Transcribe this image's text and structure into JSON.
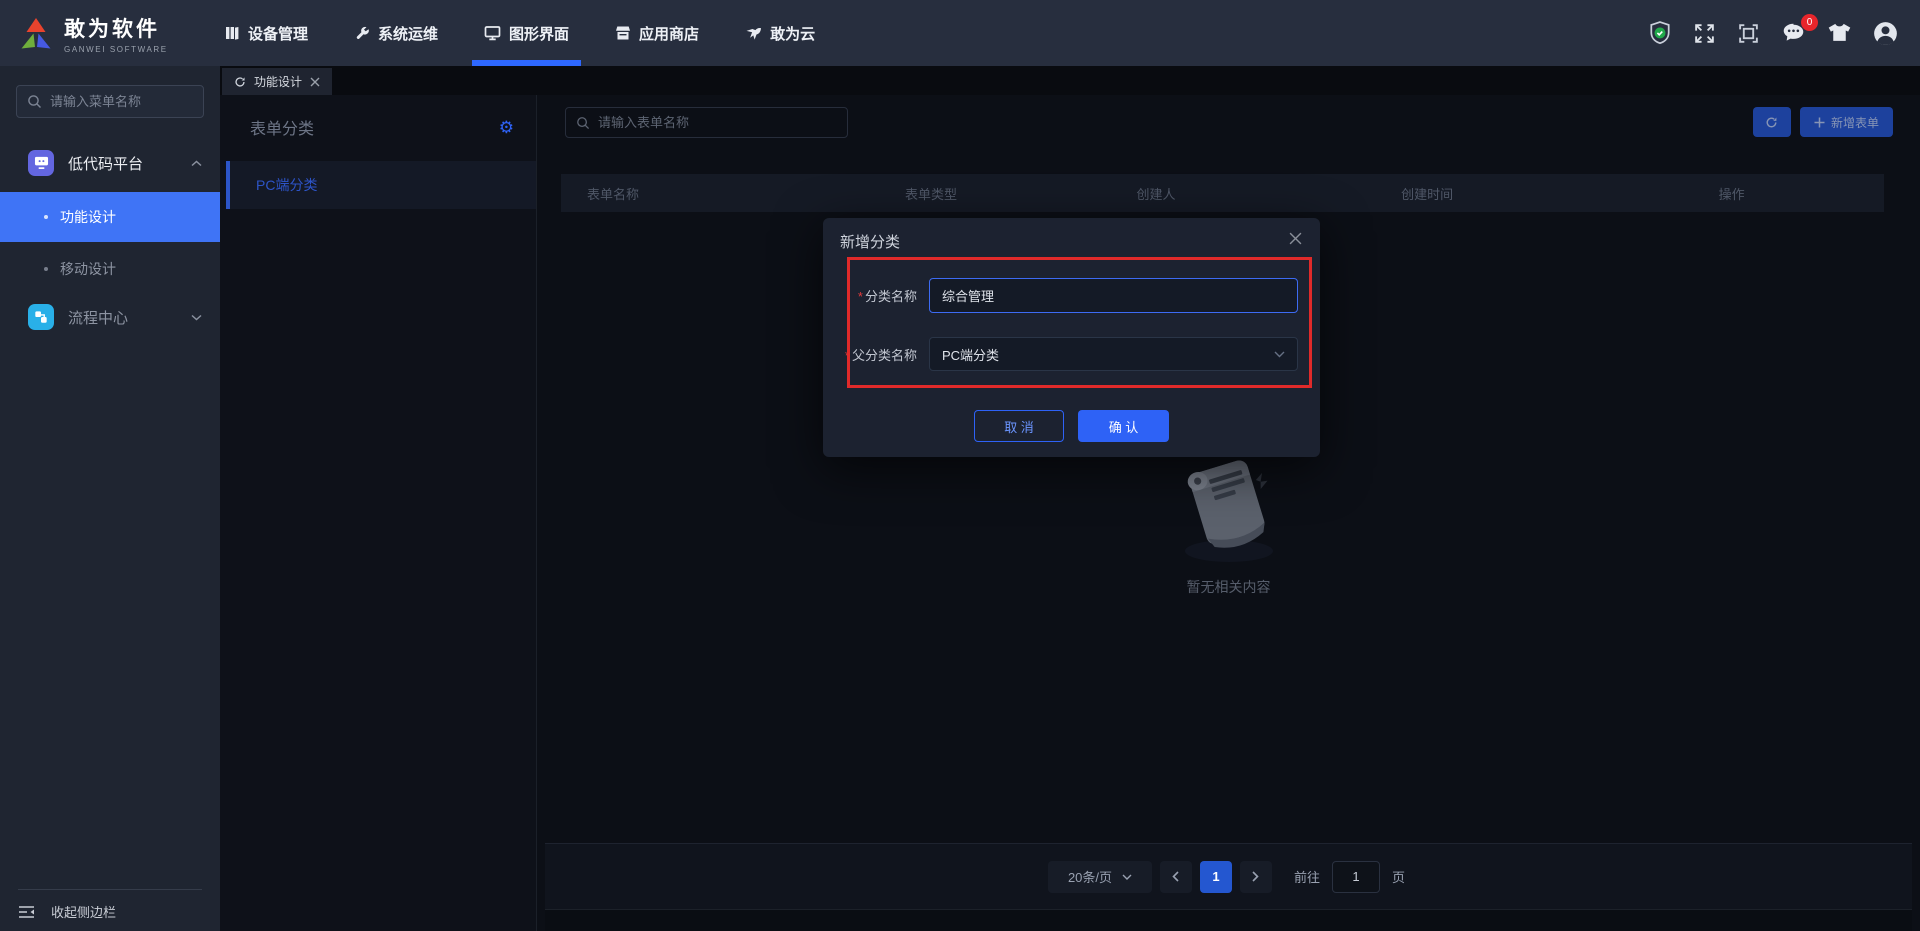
{
  "brand": {
    "name": "敢为软件",
    "subtitle": "GANWEI SOFTWARE"
  },
  "nav": {
    "items": [
      {
        "label": "设备管理",
        "icon": "devices-icon",
        "active": false
      },
      {
        "label": "系统运维",
        "icon": "ops-icon",
        "active": false
      },
      {
        "label": "图形界面",
        "icon": "gui-icon",
        "active": true
      },
      {
        "label": "应用商店",
        "icon": "store-icon",
        "active": false
      },
      {
        "label": "敢为云",
        "icon": "cloud-icon",
        "active": false
      }
    ],
    "message_badge": "0"
  },
  "sidebar": {
    "search_placeholder": "请输入菜单名称",
    "group_lowcode": {
      "label": "低代码平台",
      "expanded": true
    },
    "item_function_design": {
      "label": "功能设计",
      "active": true
    },
    "item_mobile_design": {
      "label": "移动设计",
      "active": false
    },
    "group_flow": {
      "label": "流程中心",
      "expanded": false
    },
    "collapse_label": "收起侧边栏"
  },
  "tab": {
    "label": "功能设计"
  },
  "panel": {
    "title": "表单分类",
    "selected_item": "PC端分类"
  },
  "toolbar": {
    "search_placeholder": "请输入表单名称",
    "add_button": "新增表单"
  },
  "table": {
    "columns": [
      "表单名称",
      "表单类型",
      "创建人",
      "创建时间",
      "操作"
    ],
    "rows": []
  },
  "empty": {
    "text": "暂无相关内容"
  },
  "pagination": {
    "per_page": "20条/页",
    "current_page": "1",
    "goto_label": "前往",
    "goto_value": "1",
    "page_suffix": "页"
  },
  "modal": {
    "title": "新增分类",
    "required_mark": "*",
    "fields": [
      {
        "label": "分类名称",
        "value": "综合管理"
      },
      {
        "label": "父分类名称",
        "value": "PC端分类"
      }
    ],
    "cancel": "取 消",
    "confirm": "确 认"
  },
  "icons": {
    "gear": "⚙"
  },
  "colors": {
    "accent": "#2e62f6",
    "annotation": "#e02a2a",
    "active_menu": "#3f74f6",
    "badge": "#e8252b"
  }
}
